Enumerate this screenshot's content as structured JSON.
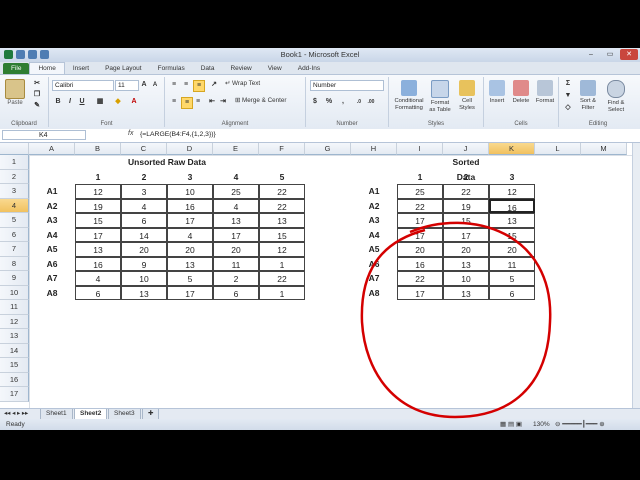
{
  "window": {
    "title": "Book1 - Microsoft Excel"
  },
  "ribbon_tabs": [
    "File",
    "Home",
    "Insert",
    "Page Layout",
    "Formulas",
    "Data",
    "Review",
    "View",
    "Add-Ins"
  ],
  "ribbon": {
    "paste": "Paste",
    "font_name": "Calibri",
    "font_size": "11",
    "wrap_text": "Wrap Text",
    "merge_center": "Merge & Center",
    "number_format": "Number",
    "conditional_formatting": "Conditional Formatting",
    "format_as_table": "Format as Table",
    "cell_styles": "Cell Styles",
    "insert": "Insert",
    "delete": "Delete",
    "format": "Format",
    "sort_filter": "Sort & Filter",
    "find_select": "Find & Select",
    "groups": [
      "Clipboard",
      "Font",
      "Alignment",
      "Number",
      "Styles",
      "Cells",
      "Editing"
    ]
  },
  "formula_bar": {
    "name_box": "K4",
    "fx": "fx",
    "formula": "{=LARGE(B4:F4,{1,2,3})}"
  },
  "columns": [
    "A",
    "B",
    "C",
    "D",
    "E",
    "F",
    "G",
    "H",
    "I",
    "J",
    "K",
    "L",
    "M"
  ],
  "rows": [
    "1",
    "2",
    "3",
    "4",
    "5",
    "6",
    "7",
    "8",
    "9",
    "10",
    "11",
    "12",
    "13",
    "14",
    "15",
    "16",
    "17"
  ],
  "left_table": {
    "title": "Unsorted Raw Data",
    "col_headers": [
      "1",
      "2",
      "3",
      "4",
      "5"
    ],
    "row_labels": [
      "A1",
      "A2",
      "A3",
      "A4",
      "A5",
      "A6",
      "A7",
      "A8"
    ],
    "values": [
      [
        "12",
        "3",
        "10",
        "25",
        "22"
      ],
      [
        "19",
        "4",
        "16",
        "4",
        "22"
      ],
      [
        "15",
        "6",
        "17",
        "13",
        "13"
      ],
      [
        "17",
        "14",
        "4",
        "17",
        "15"
      ],
      [
        "13",
        "20",
        "20",
        "20",
        "12"
      ],
      [
        "16",
        "9",
        "13",
        "11",
        "1"
      ],
      [
        "4",
        "10",
        "5",
        "2",
        "22"
      ],
      [
        "6",
        "13",
        "17",
        "6",
        "1"
      ]
    ]
  },
  "right_table": {
    "title": "Sorted Data",
    "col_headers": [
      "1",
      "2",
      "3"
    ],
    "row_labels": [
      "A1",
      "A2",
      "A3",
      "A4",
      "A5",
      "A6",
      "A7",
      "A8"
    ],
    "values": [
      [
        "25",
        "22",
        "12"
      ],
      [
        "22",
        "19",
        "16"
      ],
      [
        "17",
        "15",
        "13"
      ],
      [
        "17",
        "17",
        "15"
      ],
      [
        "20",
        "20",
        "20"
      ],
      [
        "16",
        "13",
        "11"
      ],
      [
        "22",
        "10",
        "5"
      ],
      [
        "17",
        "13",
        "6"
      ]
    ]
  },
  "sheet_tabs": [
    "Sheet1",
    "Sheet2",
    "Sheet3"
  ],
  "active_sheet": "Sheet2",
  "status": {
    "ready": "Ready",
    "zoom": "130%"
  },
  "colors": {
    "accent": "#2e7d32",
    "annotation": "#d40000",
    "selection": "#f1c15f"
  }
}
